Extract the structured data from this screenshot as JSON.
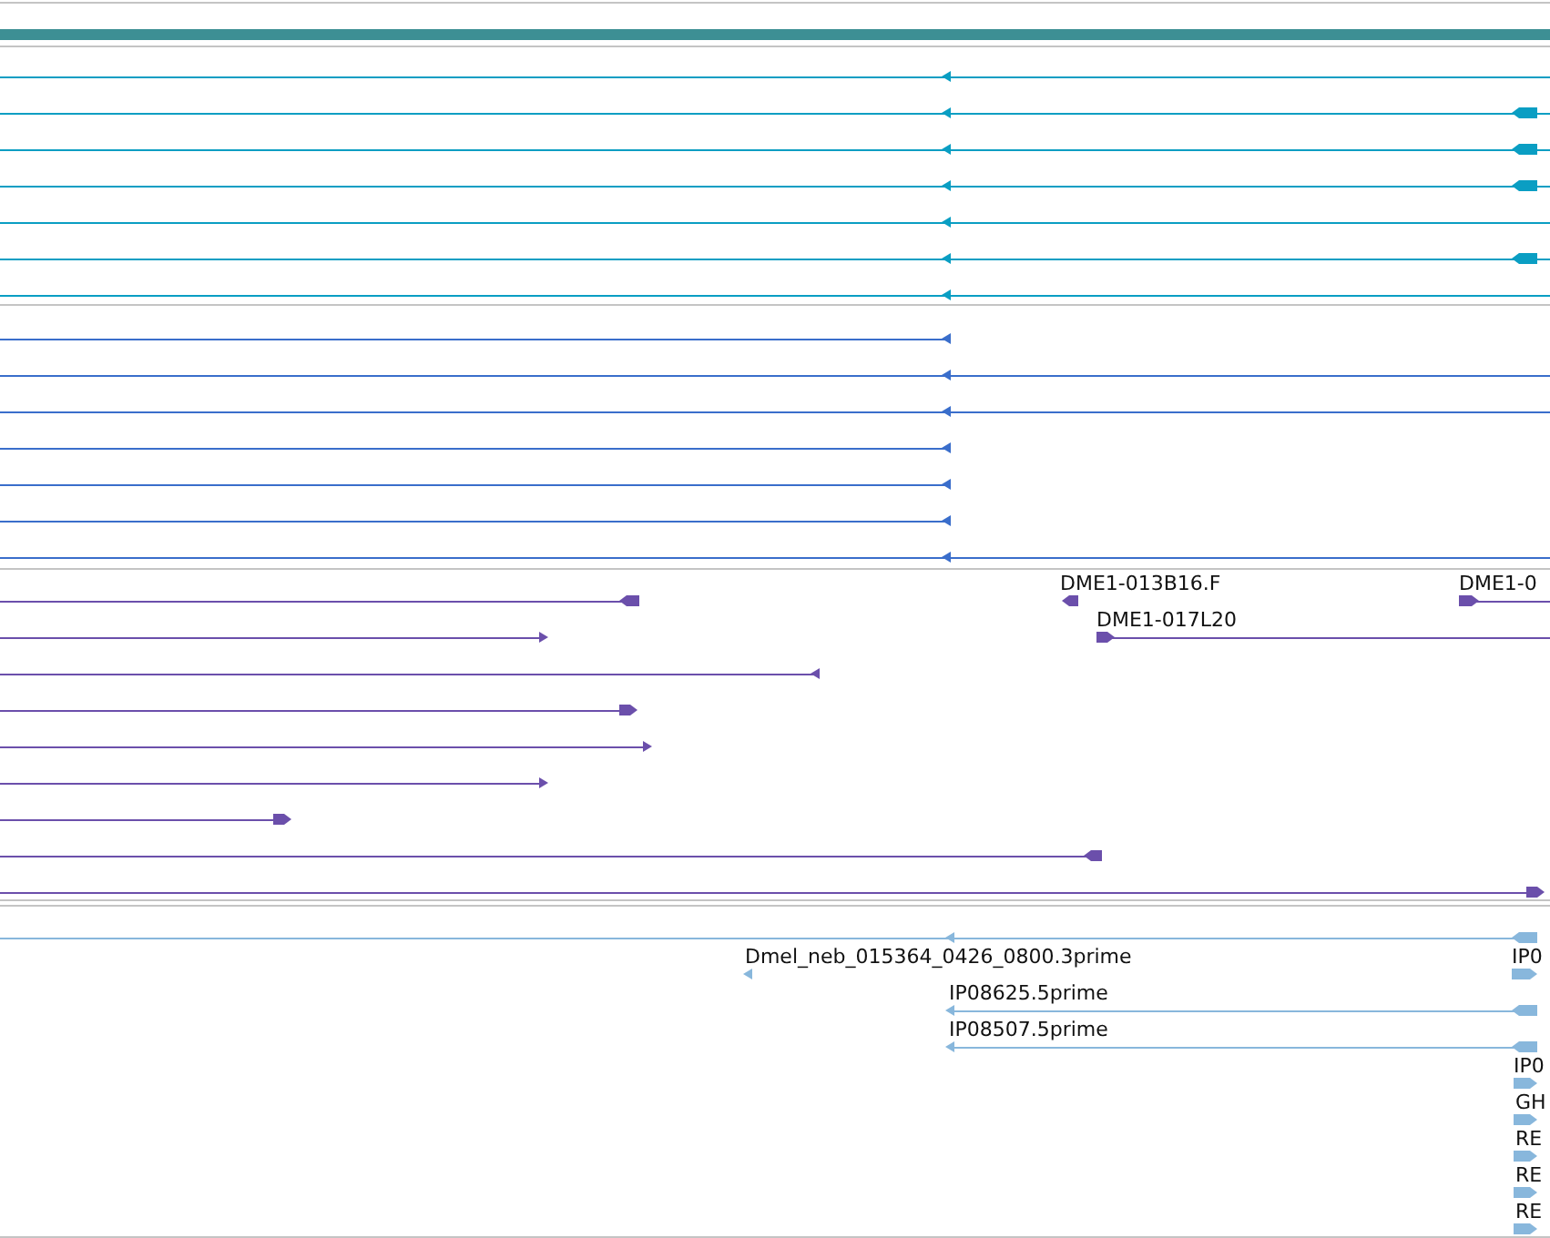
{
  "tracks": [
    {
      "kind": "bar",
      "color": "#3d8f94"
    },
    {
      "kind": "features",
      "color": "#0a9ec3",
      "features": [
        {
          "reverse": true
        },
        {
          "reverse": true
        },
        {
          "reverse": true
        },
        {
          "reverse": true
        },
        {
          "reverse": true
        },
        {
          "reverse": true
        },
        {
          "reverse": true
        }
      ]
    },
    {
      "kind": "features",
      "color": "#3a6ecb",
      "features": [
        {
          "reverse": true
        },
        {
          "reverse": true
        },
        {
          "reverse": true
        },
        {
          "reverse": true
        },
        {
          "reverse": true
        },
        {
          "reverse": true
        },
        {
          "reverse": true
        }
      ]
    },
    {
      "kind": "features",
      "color": "#6b4fab",
      "features": [
        {
          "reverse": true
        },
        {
          "label": "DME1-013B16.F",
          "reverse": true
        },
        {
          "label": "DME1-0",
          "reverse": false
        },
        {
          "reverse": false
        },
        {
          "label": "DME1-017L20",
          "reverse": false
        },
        {
          "reverse": true
        },
        {
          "reverse": false
        },
        {
          "reverse": false
        },
        {
          "reverse": false
        },
        {
          "reverse": false
        },
        {
          "reverse": true
        },
        {
          "reverse": false
        }
      ]
    },
    {
      "kind": "features",
      "color": "#88b7dc",
      "features": [
        {
          "reverse": true
        },
        {
          "label": "Dmel_neb_015364_0426_0800.3prime",
          "reverse": true
        },
        {
          "label": "IP0",
          "reverse": false
        },
        {
          "label": "IP08625.5prime",
          "reverse": true
        },
        {
          "label": "IP08507.5prime",
          "reverse": true
        },
        {
          "label": "IP0",
          "reverse": false
        },
        {
          "label": "GH",
          "reverse": false
        },
        {
          "label": "RE",
          "reverse": false
        },
        {
          "label": "RE",
          "reverse": false
        },
        {
          "label": "RE",
          "reverse": false
        }
      ]
    }
  ]
}
